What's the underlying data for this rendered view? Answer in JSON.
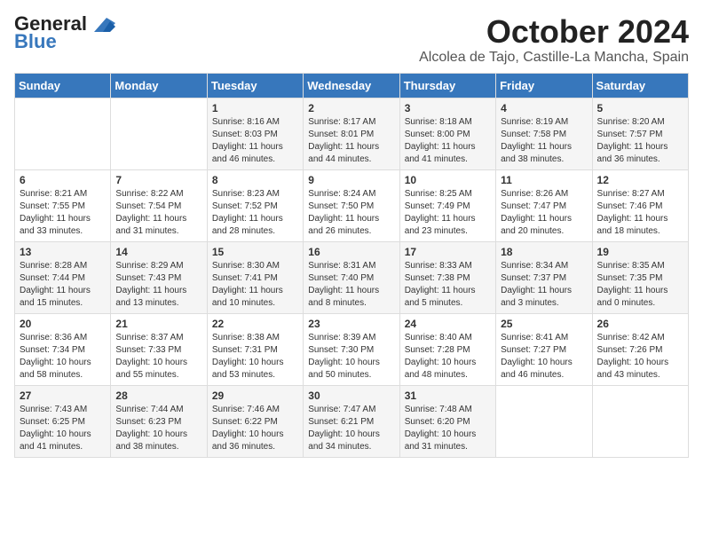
{
  "header": {
    "logo_line1": "General",
    "logo_line2": "Blue",
    "month_title": "October 2024",
    "subtitle": "Alcolea de Tajo, Castille-La Mancha, Spain"
  },
  "days_of_week": [
    "Sunday",
    "Monday",
    "Tuesday",
    "Wednesday",
    "Thursday",
    "Friday",
    "Saturday"
  ],
  "weeks": [
    [
      {
        "day": "",
        "info": ""
      },
      {
        "day": "",
        "info": ""
      },
      {
        "day": "1",
        "info": "Sunrise: 8:16 AM\nSunset: 8:03 PM\nDaylight: 11 hours and 46 minutes."
      },
      {
        "day": "2",
        "info": "Sunrise: 8:17 AM\nSunset: 8:01 PM\nDaylight: 11 hours and 44 minutes."
      },
      {
        "day": "3",
        "info": "Sunrise: 8:18 AM\nSunset: 8:00 PM\nDaylight: 11 hours and 41 minutes."
      },
      {
        "day": "4",
        "info": "Sunrise: 8:19 AM\nSunset: 7:58 PM\nDaylight: 11 hours and 38 minutes."
      },
      {
        "day": "5",
        "info": "Sunrise: 8:20 AM\nSunset: 7:57 PM\nDaylight: 11 hours and 36 minutes."
      }
    ],
    [
      {
        "day": "6",
        "info": "Sunrise: 8:21 AM\nSunset: 7:55 PM\nDaylight: 11 hours and 33 minutes."
      },
      {
        "day": "7",
        "info": "Sunrise: 8:22 AM\nSunset: 7:54 PM\nDaylight: 11 hours and 31 minutes."
      },
      {
        "day": "8",
        "info": "Sunrise: 8:23 AM\nSunset: 7:52 PM\nDaylight: 11 hours and 28 minutes."
      },
      {
        "day": "9",
        "info": "Sunrise: 8:24 AM\nSunset: 7:50 PM\nDaylight: 11 hours and 26 minutes."
      },
      {
        "day": "10",
        "info": "Sunrise: 8:25 AM\nSunset: 7:49 PM\nDaylight: 11 hours and 23 minutes."
      },
      {
        "day": "11",
        "info": "Sunrise: 8:26 AM\nSunset: 7:47 PM\nDaylight: 11 hours and 20 minutes."
      },
      {
        "day": "12",
        "info": "Sunrise: 8:27 AM\nSunset: 7:46 PM\nDaylight: 11 hours and 18 minutes."
      }
    ],
    [
      {
        "day": "13",
        "info": "Sunrise: 8:28 AM\nSunset: 7:44 PM\nDaylight: 11 hours and 15 minutes."
      },
      {
        "day": "14",
        "info": "Sunrise: 8:29 AM\nSunset: 7:43 PM\nDaylight: 11 hours and 13 minutes."
      },
      {
        "day": "15",
        "info": "Sunrise: 8:30 AM\nSunset: 7:41 PM\nDaylight: 11 hours and 10 minutes."
      },
      {
        "day": "16",
        "info": "Sunrise: 8:31 AM\nSunset: 7:40 PM\nDaylight: 11 hours and 8 minutes."
      },
      {
        "day": "17",
        "info": "Sunrise: 8:33 AM\nSunset: 7:38 PM\nDaylight: 11 hours and 5 minutes."
      },
      {
        "day": "18",
        "info": "Sunrise: 8:34 AM\nSunset: 7:37 PM\nDaylight: 11 hours and 3 minutes."
      },
      {
        "day": "19",
        "info": "Sunrise: 8:35 AM\nSunset: 7:35 PM\nDaylight: 11 hours and 0 minutes."
      }
    ],
    [
      {
        "day": "20",
        "info": "Sunrise: 8:36 AM\nSunset: 7:34 PM\nDaylight: 10 hours and 58 minutes."
      },
      {
        "day": "21",
        "info": "Sunrise: 8:37 AM\nSunset: 7:33 PM\nDaylight: 10 hours and 55 minutes."
      },
      {
        "day": "22",
        "info": "Sunrise: 8:38 AM\nSunset: 7:31 PM\nDaylight: 10 hours and 53 minutes."
      },
      {
        "day": "23",
        "info": "Sunrise: 8:39 AM\nSunset: 7:30 PM\nDaylight: 10 hours and 50 minutes."
      },
      {
        "day": "24",
        "info": "Sunrise: 8:40 AM\nSunset: 7:28 PM\nDaylight: 10 hours and 48 minutes."
      },
      {
        "day": "25",
        "info": "Sunrise: 8:41 AM\nSunset: 7:27 PM\nDaylight: 10 hours and 46 minutes."
      },
      {
        "day": "26",
        "info": "Sunrise: 8:42 AM\nSunset: 7:26 PM\nDaylight: 10 hours and 43 minutes."
      }
    ],
    [
      {
        "day": "27",
        "info": "Sunrise: 7:43 AM\nSunset: 6:25 PM\nDaylight: 10 hours and 41 minutes."
      },
      {
        "day": "28",
        "info": "Sunrise: 7:44 AM\nSunset: 6:23 PM\nDaylight: 10 hours and 38 minutes."
      },
      {
        "day": "29",
        "info": "Sunrise: 7:46 AM\nSunset: 6:22 PM\nDaylight: 10 hours and 36 minutes."
      },
      {
        "day": "30",
        "info": "Sunrise: 7:47 AM\nSunset: 6:21 PM\nDaylight: 10 hours and 34 minutes."
      },
      {
        "day": "31",
        "info": "Sunrise: 7:48 AM\nSunset: 6:20 PM\nDaylight: 10 hours and 31 minutes."
      },
      {
        "day": "",
        "info": ""
      },
      {
        "day": "",
        "info": ""
      }
    ]
  ]
}
